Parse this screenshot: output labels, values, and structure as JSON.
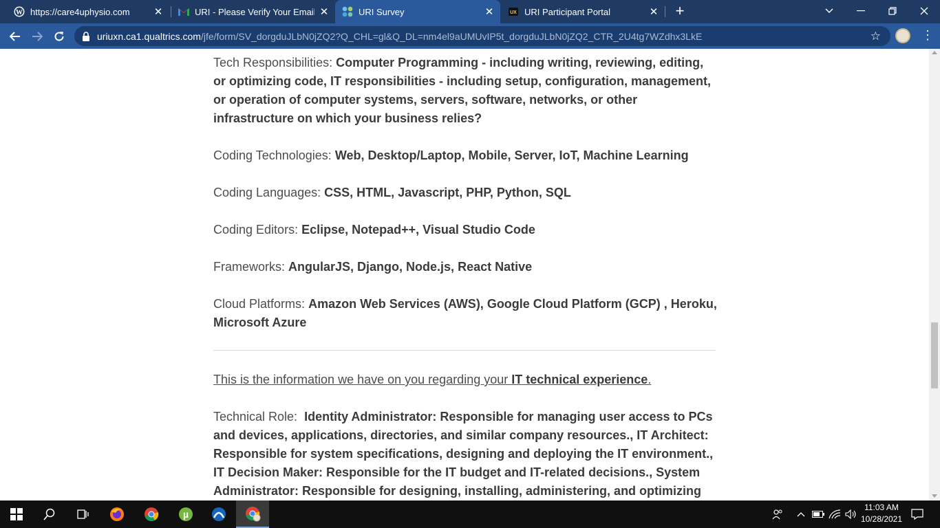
{
  "browser": {
    "tabs": [
      {
        "title": "https://care4uphysio.com",
        "icon": "wordpress-icon",
        "active": false
      },
      {
        "title": "URI - Please Verify Your Email - sl",
        "icon": "gmail-icon",
        "active": false
      },
      {
        "title": "URI Survey",
        "icon": "qualtrics-icon",
        "active": true
      },
      {
        "title": "URI Participant Portal",
        "icon": "uri-icon",
        "active": false
      }
    ],
    "address": {
      "host": "uriuxn.ca1.qualtrics.com",
      "path": "/jfe/form/SV_dorgduJLbN0jZQ2?Q_CHL=gl&Q_DL=nm4el9aUMUvIP5t_dorgduJLbN0jZQ2_CTR_2U4tg7WZdhx3LkE"
    }
  },
  "profile": {
    "tech_responsibilities_label": "Tech Responsibilities:",
    "tech_responsibilities_value": "Computer Programming - including writing, reviewing, editing, or optimizing code, IT responsibilities - including setup, configuration, management, or operation of computer systems, servers, software, networks, or other infrastructure on which your business relies?",
    "coding_technologies_label": "Coding Technologies:",
    "coding_technologies_value": "Web, Desktop/Laptop, Mobile, Server, IoT, Machine Learning",
    "coding_languages_label": "Coding Languages:",
    "coding_languages_value": "CSS, HTML, Javascript, PHP, Python, SQL",
    "coding_editors_label": "Coding Editors:",
    "coding_editors_value": "Eclipse, Notepad++, Visual Studio Code",
    "frameworks_label": "Frameworks:",
    "frameworks_value": "AngularJS, Django, Node.js, React Native",
    "cloud_platforms_label": "Cloud Platforms:",
    "cloud_platforms_value": "Amazon Web Services (AWS), Google Cloud Platform (GCP) , Heroku, Microsoft Azure"
  },
  "it_section": {
    "intro_prefix": "This is the information we have on you regarding your ",
    "intro_bold": "IT technical experience",
    "intro_suffix": ".",
    "technical_role_label": "Technical Role:",
    "technical_role_value": "Identity Administrator: Responsible for managing user access to PCs and devices, applications, directories, and similar company resources., IT Architect: Responsible for system specifications, designing and deploying the IT environment., IT Decision Maker: Responsible for the IT budget and IT-related decisions., System Administrator: Responsible for designing, installing, administering, and optimizing"
  },
  "taskbar": {
    "time": "11:03 AM",
    "date": "10/28/2021"
  }
}
